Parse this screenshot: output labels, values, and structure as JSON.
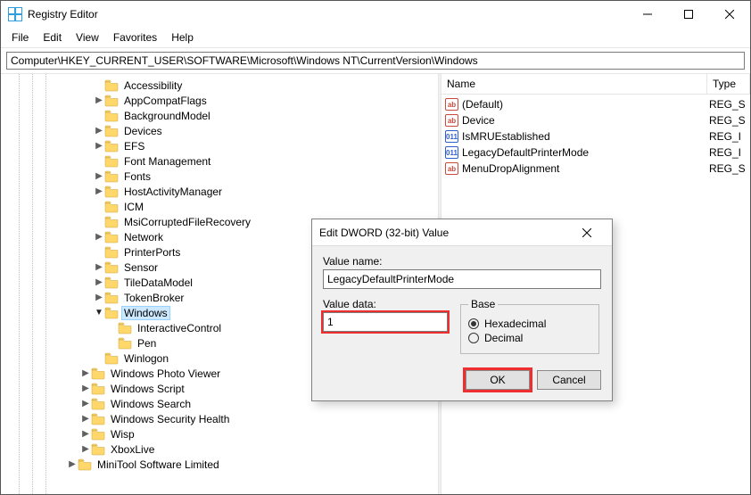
{
  "window": {
    "title": "Registry Editor"
  },
  "menu": {
    "items": [
      "File",
      "Edit",
      "View",
      "Favorites",
      "Help"
    ]
  },
  "address": "Computer\\HKEY_CURRENT_USER\\SOFTWARE\\Microsoft\\Windows NT\\CurrentVersion\\Windows",
  "tree": [
    {
      "depth": 6,
      "expand": "none",
      "label": "Accessibility"
    },
    {
      "depth": 6,
      "expand": "closed",
      "label": "AppCompatFlags"
    },
    {
      "depth": 6,
      "expand": "none",
      "label": "BackgroundModel"
    },
    {
      "depth": 6,
      "expand": "closed",
      "label": "Devices"
    },
    {
      "depth": 6,
      "expand": "closed",
      "label": "EFS"
    },
    {
      "depth": 6,
      "expand": "none",
      "label": "Font Management"
    },
    {
      "depth": 6,
      "expand": "closed",
      "label": "Fonts"
    },
    {
      "depth": 6,
      "expand": "closed",
      "label": "HostActivityManager"
    },
    {
      "depth": 6,
      "expand": "none",
      "label": "ICM"
    },
    {
      "depth": 6,
      "expand": "none",
      "label": "MsiCorruptedFileRecovery"
    },
    {
      "depth": 6,
      "expand": "closed",
      "label": "Network"
    },
    {
      "depth": 6,
      "expand": "none",
      "label": "PrinterPorts"
    },
    {
      "depth": 6,
      "expand": "closed",
      "label": "Sensor"
    },
    {
      "depth": 6,
      "expand": "closed",
      "label": "TileDataModel"
    },
    {
      "depth": 6,
      "expand": "closed",
      "label": "TokenBroker"
    },
    {
      "depth": 6,
      "expand": "open",
      "label": "Windows",
      "selected": true
    },
    {
      "depth": 7,
      "expand": "none",
      "label": "InteractiveControl"
    },
    {
      "depth": 7,
      "expand": "none",
      "label": "Pen"
    },
    {
      "depth": 6,
      "expand": "none",
      "label": "Winlogon"
    },
    {
      "depth": 5,
      "expand": "closed",
      "label": "Windows Photo Viewer"
    },
    {
      "depth": 5,
      "expand": "closed",
      "label": "Windows Script"
    },
    {
      "depth": 5,
      "expand": "closed",
      "label": "Windows Search"
    },
    {
      "depth": 5,
      "expand": "closed",
      "label": "Windows Security Health"
    },
    {
      "depth": 5,
      "expand": "closed",
      "label": "Wisp"
    },
    {
      "depth": 5,
      "expand": "closed",
      "label": "XboxLive"
    },
    {
      "depth": 4,
      "expand": "closed",
      "label": "MiniTool Software Limited"
    }
  ],
  "listHeader": {
    "name": "Name",
    "type": "Type"
  },
  "values": [
    {
      "icon": "ab",
      "name": "(Default)",
      "type": "REG_S"
    },
    {
      "icon": "ab",
      "name": "Device",
      "type": "REG_S"
    },
    {
      "icon": "01",
      "name": "IsMRUEstablished",
      "type": "REG_I"
    },
    {
      "icon": "01",
      "name": "LegacyDefaultPrinterMode",
      "type": "REG_I"
    },
    {
      "icon": "ab",
      "name": "MenuDropAlignment",
      "type": "REG_S"
    }
  ],
  "dialog": {
    "title": "Edit DWORD (32-bit) Value",
    "valueNameLabel": "Value name:",
    "valueName": "LegacyDefaultPrinterMode",
    "valueDataLabel": "Value data:",
    "valueData": "1",
    "baseLabel": "Base",
    "hexLabel": "Hexadecimal",
    "decLabel": "Decimal",
    "baseSelected": "hex",
    "ok": "OK",
    "cancel": "Cancel"
  }
}
